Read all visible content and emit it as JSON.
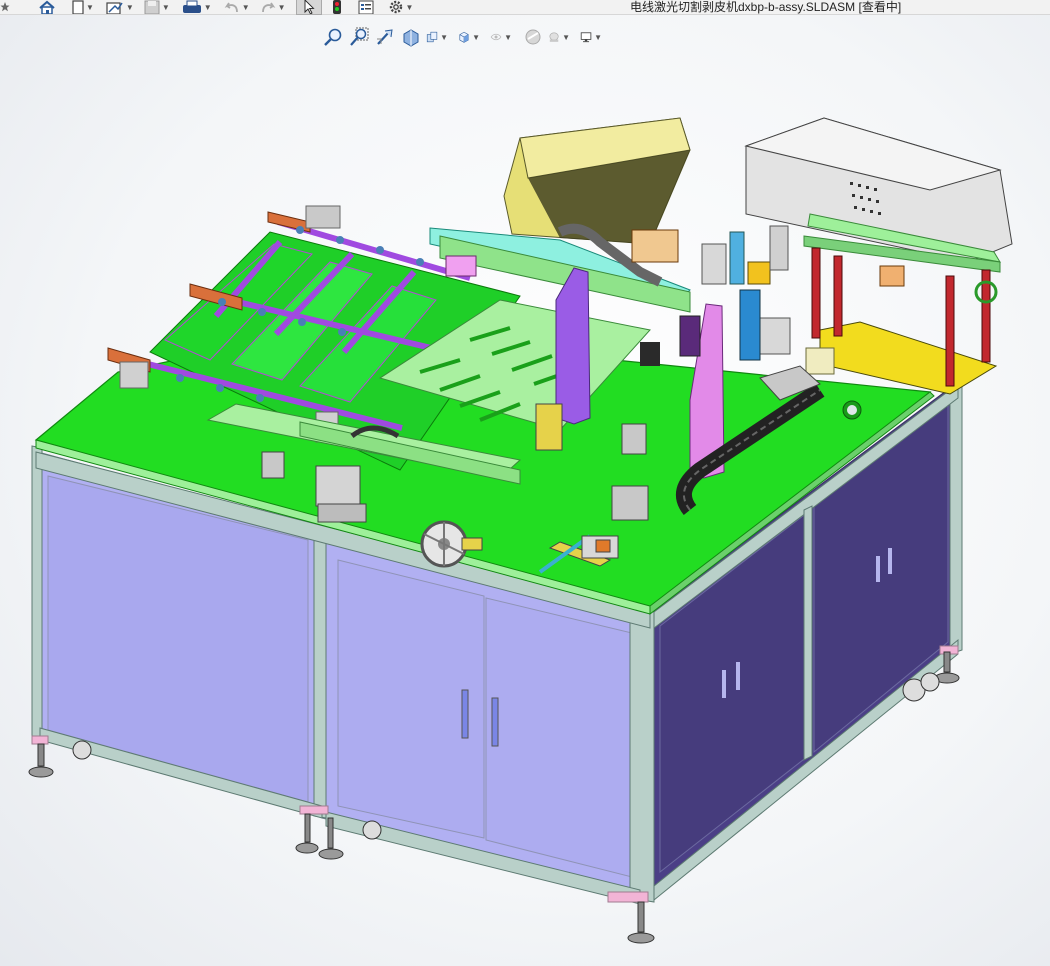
{
  "app": {
    "document_title": "电线激光切割剥皮机dxbp-b-assy.SLDASM [查看中]"
  },
  "main_toolbar": {
    "items": [
      {
        "icon": "star-icon"
      },
      {
        "icon": "home-icon"
      },
      {
        "icon": "new-document-icon"
      },
      {
        "icon": "sketch-icon"
      },
      {
        "icon": "save-icon"
      },
      {
        "icon": "print-icon"
      },
      {
        "icon": "undo-icon"
      },
      {
        "icon": "redo-icon"
      },
      {
        "icon": "select-arrow-icon"
      },
      {
        "icon": "traffic-light-icon"
      },
      {
        "icon": "file-properties-icon"
      },
      {
        "icon": "options-gear-icon"
      }
    ]
  },
  "heads_up_toolbar": {
    "items": [
      {
        "icon": "zoom-to-fit-icon"
      },
      {
        "icon": "zoom-to-area-icon"
      },
      {
        "icon": "previous-view-icon"
      },
      {
        "icon": "section-view-icon"
      },
      {
        "icon": "dynamic-annotation-icon"
      },
      {
        "icon": "view-orientation-icon"
      },
      {
        "icon": "display-style-icon"
      },
      {
        "icon": "hide-show-items-icon"
      },
      {
        "icon": "edit-appearance-icon"
      },
      {
        "icon": "apply-scene-icon"
      },
      {
        "icon": "view-settings-icon"
      }
    ]
  },
  "colors": {
    "table_top": "#22dd22",
    "cabinet_front": "#b1b0f2",
    "cabinet_side": "#4b3f86",
    "frame": "#b9d0c9",
    "laser_head": "#e3e3e3",
    "yellow_block": "#e6df76",
    "purple_parts": "#9a5ce6",
    "light_green": "#a9f0a0",
    "pink": "#f2b4d6"
  }
}
